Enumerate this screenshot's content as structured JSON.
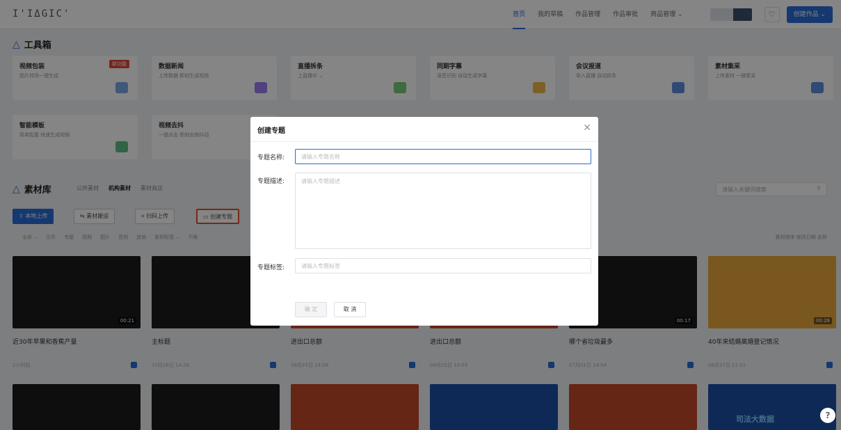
{
  "app": {
    "logo": "I'IΔGIC'"
  },
  "nav": {
    "items": [
      "首页",
      "我的草稿",
      "作品管理",
      "作品审批",
      "商品管理 ⌄"
    ],
    "create_label": "创建作品 ⌄",
    "bell_icon": "bell-icon"
  },
  "toolbox": {
    "title": "工具箱",
    "cards": [
      {
        "name": "视频包装",
        "desc": "图片转场一键生成",
        "badge": "新功能",
        "color": "#7aa7e8"
      },
      {
        "name": "数据新闻",
        "desc": "上传数据 即刻生成视频",
        "badge": "",
        "color": "#9b7ef0"
      },
      {
        "name": "直播拆条",
        "desc": "上直播中 ⌄",
        "badge": "",
        "color": "#7ac97a"
      },
      {
        "name": "同期字幕",
        "desc": "语音识别 自动生成字幕",
        "badge": "",
        "color": "#f0b84a"
      },
      {
        "name": "会议报道",
        "desc": "导入直播 自动拆条",
        "badge": "",
        "color": "#5e8de0"
      },
      {
        "name": "素材集采",
        "desc": "上传素材 一键聚采",
        "badge": "",
        "color": "#5e8de0"
      },
      {
        "name": "智能模板",
        "desc": "简单配置 快速生成视频",
        "badge": "",
        "color": "#5fbf86"
      },
      {
        "name": "视频去抖",
        "desc": "一键点击 即刻去除抖动",
        "badge": "",
        "color": "#e07a9a"
      }
    ]
  },
  "library": {
    "title": "素材库",
    "tabs": [
      "公共素材",
      "机构素材",
      "素材商店"
    ],
    "active_tab": 1,
    "search_placeholder": "请输入关键词搜索",
    "actions": [
      "本地上传",
      "素材搬运",
      "扫码上传",
      "创建专题"
    ],
    "filters": [
      "全部 ⌄",
      "文件",
      "专题",
      "视频",
      "图片",
      "音频",
      "其他",
      "素材标签 ⌄",
      "不限"
    ],
    "sort": "素材排序  修改日期  名称",
    "items": [
      {
        "title": "近30年苹果和香蕉产量",
        "date": "2小时前",
        "duration": "00:21",
        "bg": "#1c1c1c"
      },
      {
        "title": "主标题",
        "date": "10月28日 14:28",
        "duration": "",
        "bg": "#1c1c1c"
      },
      {
        "title": "进出口总额",
        "date": "08月25日 14:08",
        "duration": "",
        "bg": "#c1492a"
      },
      {
        "title": "进出口总额",
        "date": "08月25日 10:03",
        "duration": "",
        "bg": "#c1492a"
      },
      {
        "title": "哪个省垃圾最多",
        "date": "07月01日 14:04",
        "duration": "00:17",
        "bg": "#1c1c1c"
      },
      {
        "title": "40年来结婚离婚登记情况",
        "date": "06月27日 21:01",
        "duration": "00:28",
        "bg": "#e8a83a"
      }
    ],
    "row2_colors": [
      "#1c1c1c",
      "#1c1c1c",
      "#c1492a",
      "#1e4fa8",
      "#c1492a",
      "#1e4fa8"
    ],
    "row2_overlay_text": "司法大数据"
  },
  "modal": {
    "title": "创建专题",
    "close_icon": "close-icon",
    "name_label": "专题名称:",
    "name_placeholder": "请输入专题名称",
    "desc_label": "专题描述:",
    "desc_placeholder": "请输入专题描述",
    "tag_label": "专题标签:",
    "tag_placeholder": "请输入专题标签",
    "confirm_label": "确 定",
    "cancel_label": "取 消"
  },
  "help_icon": "help-icon",
  "help_label": "?"
}
